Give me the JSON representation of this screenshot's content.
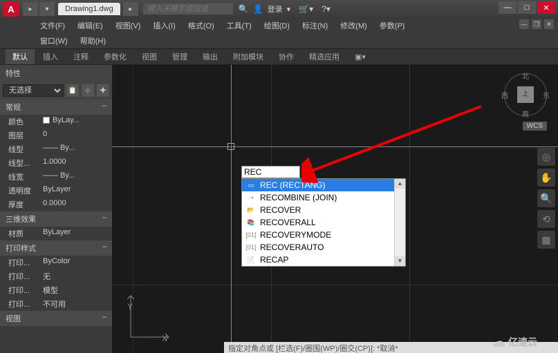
{
  "titlebar": {
    "app_logo_text": "A",
    "tab_name": "Drawing1.dwg",
    "search_placeholder": "键入关键字或短语",
    "login_label": "登录"
  },
  "menubar": {
    "items": [
      "文件(F)",
      "编辑(E)",
      "视图(V)",
      "插入(I)",
      "格式(O)",
      "工具(T)",
      "绘图(D)",
      "标注(N)",
      "修改(M)",
      "参数(P)"
    ],
    "items2": [
      "窗口(W)",
      "帮助(H)"
    ]
  },
  "ribbon": {
    "tabs": [
      "默认",
      "插入",
      "注释",
      "参数化",
      "视图",
      "管理",
      "输出",
      "附加模块",
      "协作",
      "精选应用"
    ]
  },
  "props": {
    "panel_title": "特性",
    "selection": "无选择",
    "sections": [
      {
        "title": "常规",
        "collapse": "–",
        "rows": [
          {
            "k": "颜色",
            "v": "ByLay...",
            "color": true
          },
          {
            "k": "图层",
            "v": "0"
          },
          {
            "k": "线型",
            "v": "—— By..."
          },
          {
            "k": "线型...",
            "v": "1.0000"
          },
          {
            "k": "线宽",
            "v": "—— By..."
          },
          {
            "k": "透明度",
            "v": "ByLayer"
          },
          {
            "k": "厚度",
            "v": "0.0000"
          }
        ]
      },
      {
        "title": "三维效果",
        "collapse": "–",
        "rows": [
          {
            "k": "材质",
            "v": "ByLayer"
          }
        ]
      },
      {
        "title": "打印样式",
        "collapse": "–",
        "rows": [
          {
            "k": "打印...",
            "v": "ByColor"
          },
          {
            "k": "打印...",
            "v": "无"
          },
          {
            "k": "打印...",
            "v": "模型"
          },
          {
            "k": "打印...",
            "v": "不可用"
          }
        ]
      },
      {
        "title": "视图",
        "collapse": "–",
        "rows": []
      }
    ]
  },
  "canvas": {
    "ucs_y": "Y",
    "ucs_x": "X",
    "input_value": "REC",
    "options": [
      {
        "icon": "▭",
        "label": "REC (RECTANG)",
        "sel": true
      },
      {
        "icon": "⇢",
        "label": "RECOMBINE (JOIN)"
      },
      {
        "icon": "📂",
        "label": "RECOVER"
      },
      {
        "icon": "📚",
        "label": "RECOVERALL"
      },
      {
        "icon": "[01]",
        "label": "RECOVERYMODE"
      },
      {
        "icon": "[01]",
        "label": "RECOVERAUTO"
      },
      {
        "icon": "📄",
        "label": "RECAP"
      }
    ],
    "viewcube": {
      "n": "北",
      "s": "南",
      "e": "东",
      "w": "西",
      "top": "上"
    },
    "wcs": "WCS",
    "cmdline": "指定对角点或 [栏选(F)/圈围(WP)/圈交(CP)]: *取消*"
  },
  "watermark": "亿速云"
}
